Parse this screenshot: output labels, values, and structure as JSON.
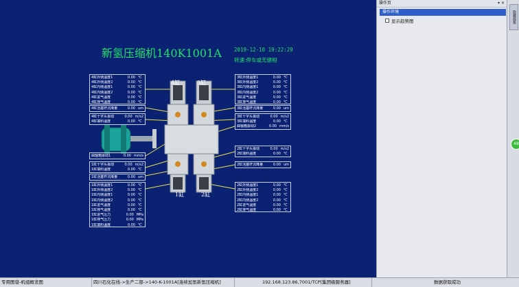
{
  "title": "新氢压缩机140K1001A",
  "datetime": "2019-12-10  19:22:29",
  "speed_text": "转速:停车或无键相",
  "cylinder_labels": {
    "c4": "4缸",
    "c3": "3缸",
    "c1": "1缸",
    "c2": "2缸"
  },
  "panels": {
    "p4_left": [
      {
        "label": "4缸外侧温度1",
        "value": "0.00",
        "unit": "℃"
      },
      {
        "label": "4缸外侧温度2",
        "value": "0.00",
        "unit": "℃"
      },
      {
        "label": "4缸内侧温度1",
        "value": "0.00",
        "unit": "℃"
      },
      {
        "label": "4缸内侧温度2",
        "value": "0.00",
        "unit": "℃"
      },
      {
        "label": "4缸进气温度",
        "value": "0.00",
        "unit": "℃"
      },
      {
        "label": "4缸排气温度",
        "value": "0.00",
        "unit": "℃"
      }
    ],
    "p4_mid": [
      {
        "label": "4缸活塞杆沉降量",
        "value": "0.00",
        "unit": "um"
      }
    ],
    "p4_vib": [
      {
        "label": "4缸十字头振动",
        "value": "0.00",
        "unit": "m/s2"
      },
      {
        "label": "4缸填料温度",
        "value": "0.00",
        "unit": "℃"
      }
    ],
    "p3_right": [
      {
        "label": "3缸外侧温度1",
        "value": "0.00",
        "unit": "℃"
      },
      {
        "label": "3缸外侧温度2",
        "value": "0.00",
        "unit": "℃"
      },
      {
        "label": "3缸内侧温度1",
        "value": "0.00",
        "unit": "℃"
      },
      {
        "label": "3缸内侧温度2",
        "value": "0.00",
        "unit": "℃"
      },
      {
        "label": "3缸进气温度",
        "value": "0.00",
        "unit": "℃"
      },
      {
        "label": "3缸排气温度",
        "value": "0.00",
        "unit": "℃"
      }
    ],
    "p3_mid": [
      {
        "label": "3缸活塞杆沉降量",
        "value": "0.00",
        "unit": "um"
      }
    ],
    "p3_vib": [
      {
        "label": "3缸十字头振动",
        "value": "0.00",
        "unit": "m/s2"
      },
      {
        "label": "3缸填料温度",
        "value": "0.00",
        "unit": "℃"
      },
      {
        "label": "曲轴箱振动2",
        "value": "0.00",
        "unit": "mm/s"
      }
    ],
    "p_motor": [
      {
        "label": "曲轴箱振动1",
        "value": "0.00",
        "unit": "mm/s"
      }
    ],
    "p1_vib": [
      {
        "label": "1缸十字头振动",
        "value": "0.00",
        "unit": "m/s2"
      },
      {
        "label": "1缸填料温度",
        "value": "0.00",
        "unit": "℃"
      }
    ],
    "p1_mid": [
      {
        "label": "1缸活塞杆沉降量",
        "value": "0.00",
        "unit": "um"
      }
    ],
    "p1_left": [
      {
        "label": "1缸外侧温度1",
        "value": "0.00",
        "unit": "℃"
      },
      {
        "label": "1缸外侧温度2",
        "value": "0.00",
        "unit": "℃"
      },
      {
        "label": "1缸内侧温度1",
        "value": "0.00",
        "unit": "℃"
      },
      {
        "label": "1缸内侧温度2",
        "value": "0.00",
        "unit": "℃"
      },
      {
        "label": "1缸进气温度",
        "value": "0.00",
        "unit": "℃"
      },
      {
        "label": "1缸排气温度",
        "value": "0.00",
        "unit": "℃"
      },
      {
        "label": "1缸进气压力",
        "value": "0.00",
        "unit": "MPa"
      },
      {
        "label": "1缸排气压力",
        "value": "0.00",
        "unit": "MPa"
      },
      {
        "label": "1缸填料温度",
        "value": "0.00",
        "unit": "℃"
      }
    ],
    "p2_vib": [
      {
        "label": "2缸十字头振动",
        "value": "0.00",
        "unit": "m/s2"
      },
      {
        "label": "2缸填料温度",
        "value": "0.00",
        "unit": "℃"
      }
    ],
    "p2_mid": [
      {
        "label": "2缸活塞杆沉降量",
        "value": "0.00",
        "unit": "um"
      }
    ],
    "p2_right": [
      {
        "label": "2缸外侧温度1",
        "value": "0.00",
        "unit": "℃"
      },
      {
        "label": "2缸外侧温度2",
        "value": "0.00",
        "unit": "℃"
      },
      {
        "label": "2缸内侧温度1",
        "value": "0.00",
        "unit": "℃"
      },
      {
        "label": "2缸内侧温度2",
        "value": "0.00",
        "unit": "℃"
      },
      {
        "label": "2缸进气温度",
        "value": "0.00",
        "unit": "℃"
      },
      {
        "label": "2缸排气温度",
        "value": "0.00",
        "unit": "℃"
      }
    ]
  },
  "side_panel": {
    "title": "操作页",
    "controls": "▾ ✕",
    "tab": "操作环境",
    "item": "显示趋势图"
  },
  "far_right": {
    "tab": "隐藏面板",
    "button": "48"
  },
  "status_bar": {
    "left": "专用图谱-机组概览图",
    "path": "四川石化在线->生产二部->140-K-1001A[连续加氢新氢压缩机]",
    "server": "192.168.123.86,7001/TCP[集团级服务器]",
    "status": "数据获取成功"
  },
  "colors": {
    "background": "#0b2273",
    "title": "#22e06a",
    "panel_border": "#c9d3ff"
  }
}
